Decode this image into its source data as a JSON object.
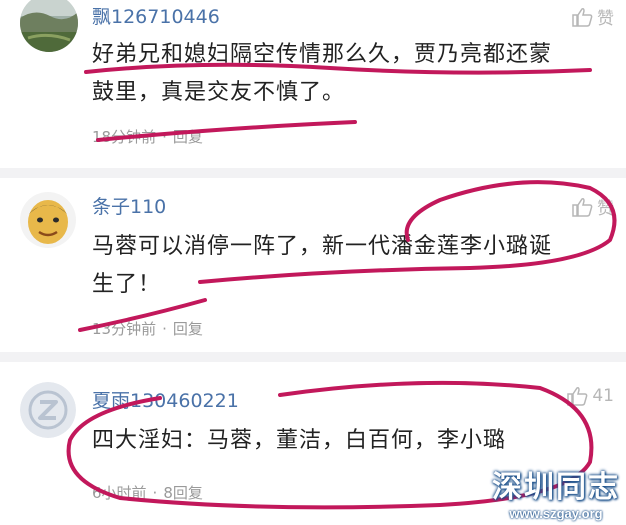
{
  "comments": [
    {
      "username": "飘126710446",
      "like_label": "赞",
      "lines": [
        "好弟兄和媳妇隔空传情那么久，贾乃亮都还蒙",
        "鼓里，真是交友不慎了。"
      ],
      "time": "18分钟前",
      "reply_label": "回复"
    },
    {
      "username": "条子110",
      "like_label": "赞",
      "lines": [
        "马蓉可以消停一阵了，新一代潘金莲李小璐诞",
        "生了！"
      ],
      "time": "13分钟前",
      "reply_label": "回复"
    },
    {
      "username": "夏雨130460221",
      "like_count": "41",
      "lines": [
        "四大淫妇：马蓉，董洁，白百何，李小璐"
      ],
      "time": "6小时前",
      "reply_label": "8回复"
    }
  ],
  "watermark": {
    "name": "深圳同志",
    "url": "www.szgay.org"
  },
  "colors": {
    "username": "#4a72a8",
    "annotation": "#c2185b",
    "meta": "#9a9a9a"
  }
}
